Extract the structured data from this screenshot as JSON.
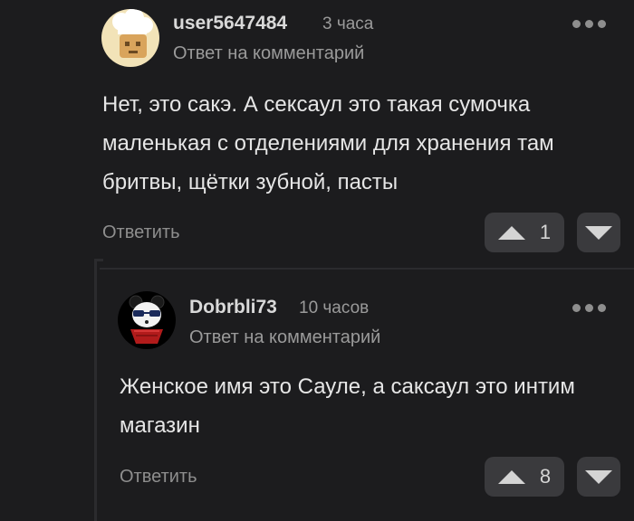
{
  "comments": [
    {
      "username": "user5647484",
      "time": "3 часа",
      "reply_to": "Ответ на комментарий",
      "text": "Нет, это сакэ. А сексаул это такая сумочка маленькая с отделениями для хранения там бритвы, щётки зубной, пасты",
      "reply_label": "Ответить",
      "rating": "1",
      "avatar_icon": "chef-hat-cartoon-avatar"
    },
    {
      "username": "Dobrbli73",
      "time": "10 часов",
      "reply_to": "Ответ на комментарий",
      "text": "Женское имя это Сауле, а саксаул это интим магазин",
      "reply_label": "Ответить",
      "rating": "8",
      "avatar_icon": "panda-sunglasses-avatar"
    }
  ],
  "colors": {
    "background": "#1c1c1e",
    "button": "#3a3a3d",
    "text": "#e6e6e6",
    "muted": "#9a9a9a"
  }
}
